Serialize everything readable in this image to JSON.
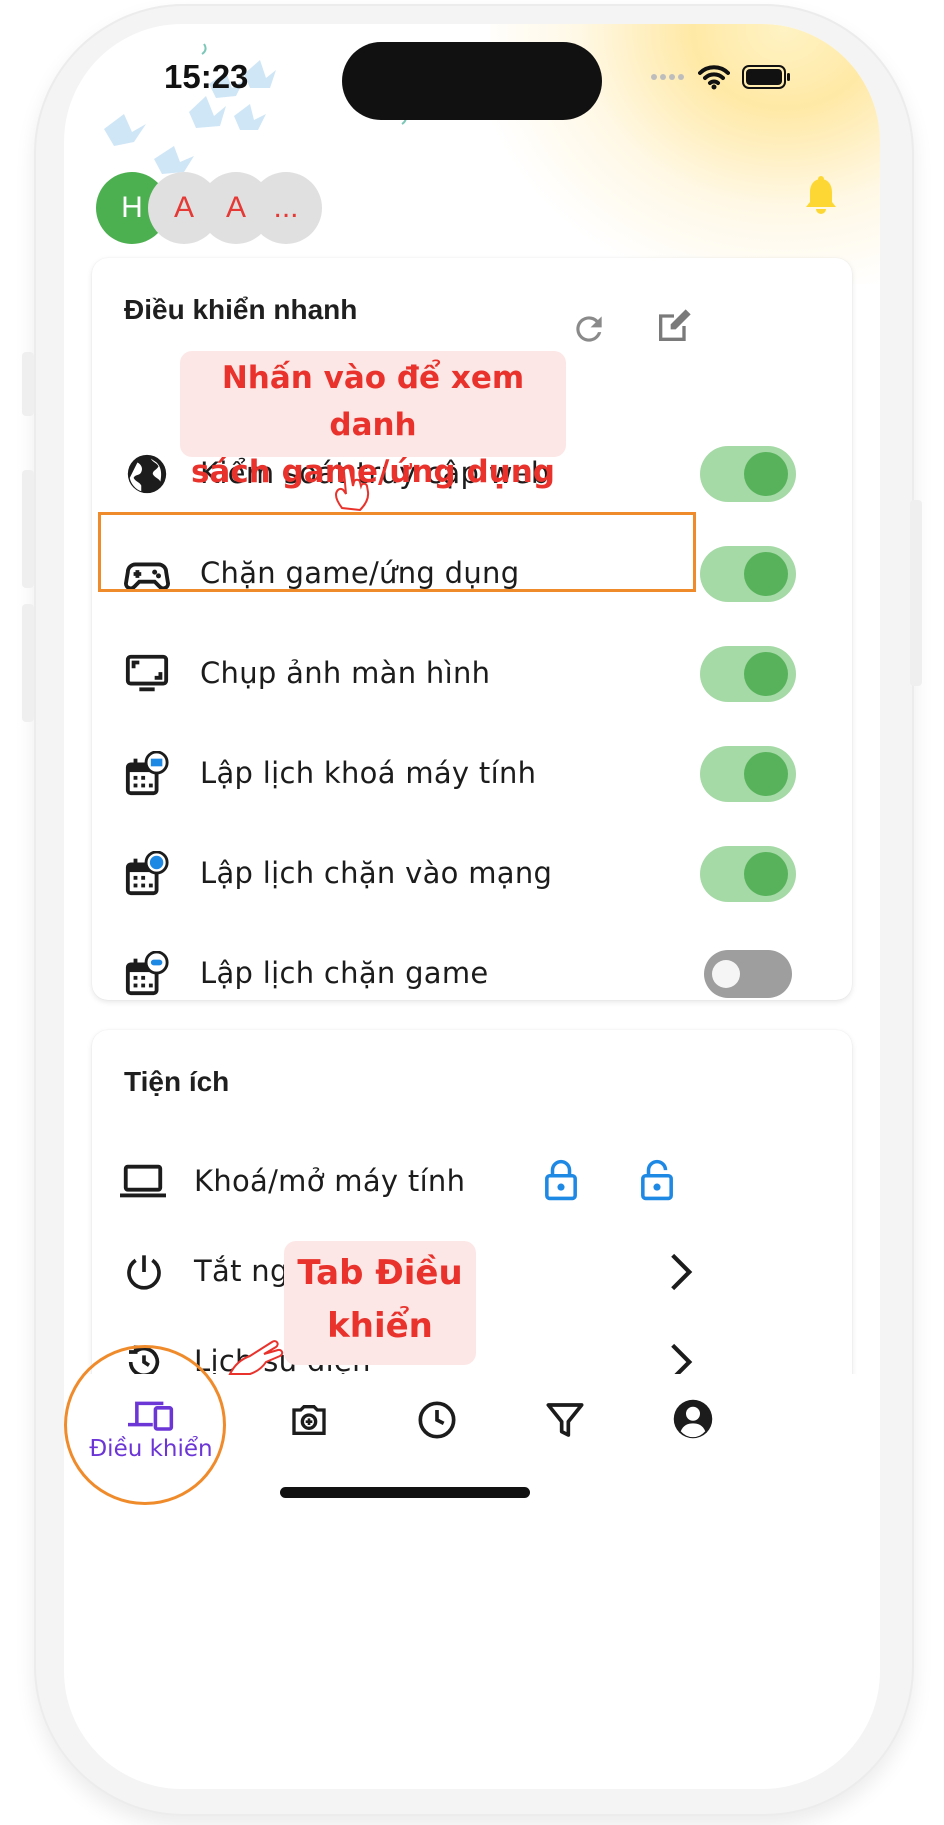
{
  "status_bar": {
    "time": "15:23"
  },
  "profiles": [
    {
      "initial": "H",
      "bg": "#4caf50",
      "fg": "#ffffff"
    },
    {
      "initial": "A",
      "bg": "#e0e0e0",
      "fg": "#e53935"
    },
    {
      "initial": "A",
      "bg": "#e0e0e0",
      "fg": "#e53935"
    },
    {
      "initial": "...",
      "bg": "#e0e0e0",
      "fg": "#e53935"
    }
  ],
  "quick_controls": {
    "title": "Điều khiển nhanh",
    "items": [
      {
        "label": "Kiểm soát truy cập web",
        "icon": "globe-icon",
        "enabled": true
      },
      {
        "label": "Chặn game/ứng dụng",
        "icon": "gamepad-icon",
        "enabled": true
      },
      {
        "label": "Chụp ảnh màn hình",
        "icon": "screenshot-monitor-icon",
        "enabled": true
      },
      {
        "label": "Lập lịch khoá máy tính",
        "icon": "schedule-computer-icon",
        "enabled": true
      },
      {
        "label": "Lập lịch chặn vào mạng",
        "icon": "schedule-web-icon",
        "enabled": true
      },
      {
        "label": "Lập lịch chặn game",
        "icon": "schedule-game-icon",
        "enabled": false
      }
    ]
  },
  "utilities": {
    "title": "Tiện ích",
    "items": [
      {
        "label": "Khoá/mở máy tính",
        "icon": "laptop-icon"
      },
      {
        "label": "Tắt nguồn",
        "icon": "power-icon"
      },
      {
        "label": "Lịch sử điện",
        "icon": "history-icon"
      }
    ]
  },
  "callouts": {
    "top": [
      "Nhấn vào để xem danh",
      "sách game/ứng dụng"
    ],
    "bottom": [
      "Tab Điều",
      "khiển"
    ]
  },
  "bottom_nav": {
    "items": [
      {
        "label": "Điều khiển",
        "icon": "devices-icon",
        "active": true
      },
      {
        "label": "",
        "icon": "camera-icon",
        "active": false
      },
      {
        "label": "",
        "icon": "clock-icon",
        "active": false
      },
      {
        "label": "",
        "icon": "filter-icon",
        "active": false
      },
      {
        "label": "",
        "icon": "account-icon",
        "active": false
      }
    ]
  },
  "colors": {
    "accent": "#6c35d6",
    "toggle_on_track": "#a5d9a6",
    "toggle_on_knob": "#57b25b",
    "annotation": "#f08b2b",
    "callout_text": "#e8322b",
    "callout_bg": "#fde6e6",
    "bell": "#fdd835",
    "lock_blue": "#1e88e5"
  }
}
